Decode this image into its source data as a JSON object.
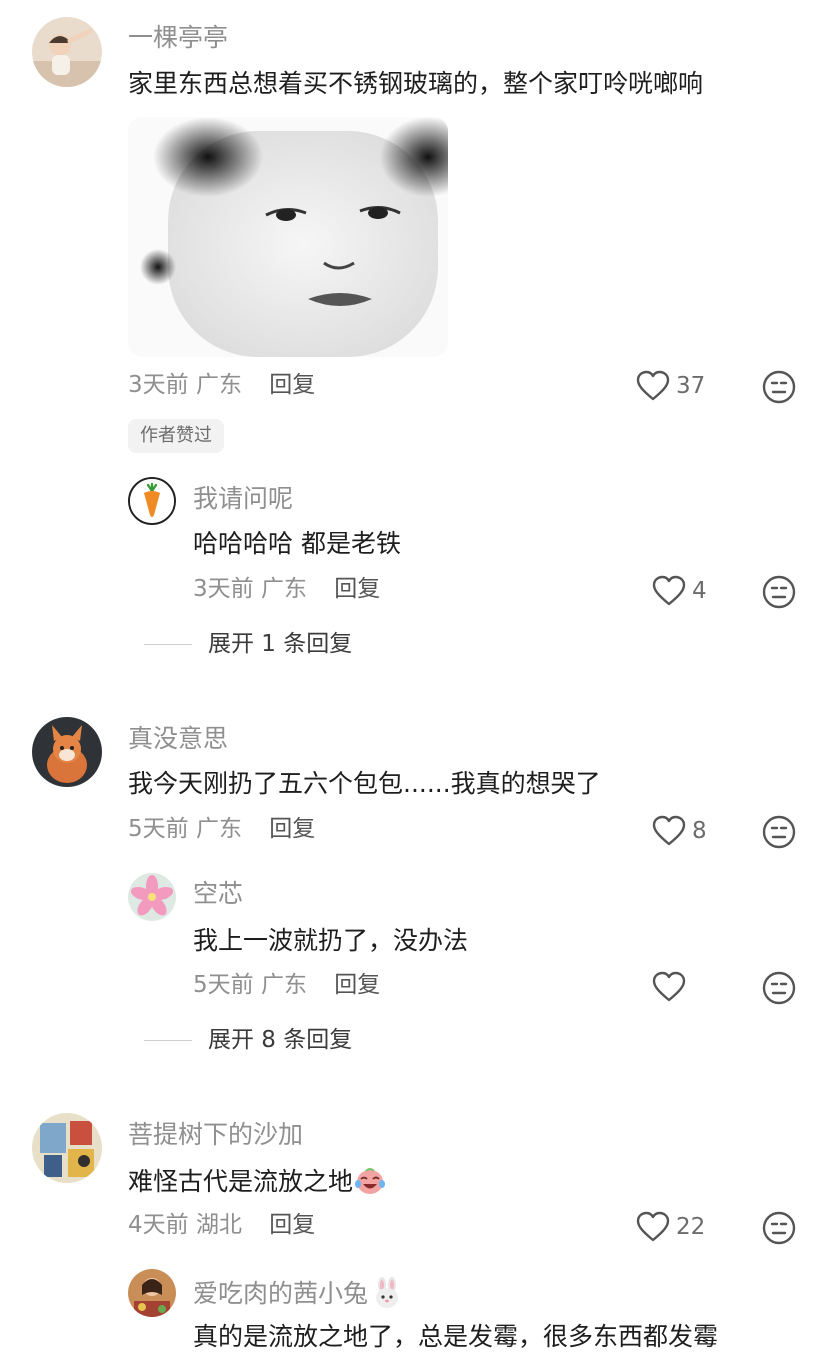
{
  "comments": [
    {
      "user": "一棵亭亭",
      "text": "家里东西总想着买不锈钢玻璃的，整个家叮呤咣啷响",
      "meta_time": "3天前",
      "meta_location": "广东",
      "reply_label": "回复",
      "likes": "37",
      "badge": "作者赞过",
      "replies": [
        {
          "user": "我请问呢",
          "text": "哈哈哈哈 都是老铁",
          "meta_time": "3天前",
          "meta_location": "广东",
          "reply_label": "回复",
          "likes": "4"
        }
      ],
      "expand_label": "展开 1 条回复"
    },
    {
      "user": "真没意思",
      "text": "我今天刚扔了五六个包包......我真的想哭了",
      "meta_time": "5天前",
      "meta_location": "广东",
      "reply_label": "回复",
      "likes": "8",
      "replies": [
        {
          "user": "空芯",
          "text": "我上一波就扔了，没办法",
          "meta_time": "5天前",
          "meta_location": "广东",
          "reply_label": "回复",
          "likes": ""
        }
      ],
      "expand_label": "展开 8 条回复"
    },
    {
      "user": "菩提树下的沙加",
      "text": "难怪古代是流放之地",
      "meta_time": "4天前",
      "meta_location": "湖北",
      "reply_label": "回复",
      "likes": "22",
      "replies": [
        {
          "user": "爱吃肉的茜小兔",
          "text": "真的是流放之地了，总是发霉，很多东西都发霉",
          "meta_time": "",
          "meta_location": "",
          "reply_label": "",
          "likes": ""
        }
      ]
    }
  ],
  "icons": {
    "like": "heart-outline-icon",
    "dislike": "neutral-face-icon",
    "emoji_crying_laugh": "tears-of-joy-emoji",
    "emoji_rabbit": "rabbit-face-emoji"
  },
  "colors": {
    "name": "#8f8f8f",
    "text": "#1e1e1e",
    "meta": "#8f8f8f",
    "badge_bg": "#f2f2f2"
  }
}
